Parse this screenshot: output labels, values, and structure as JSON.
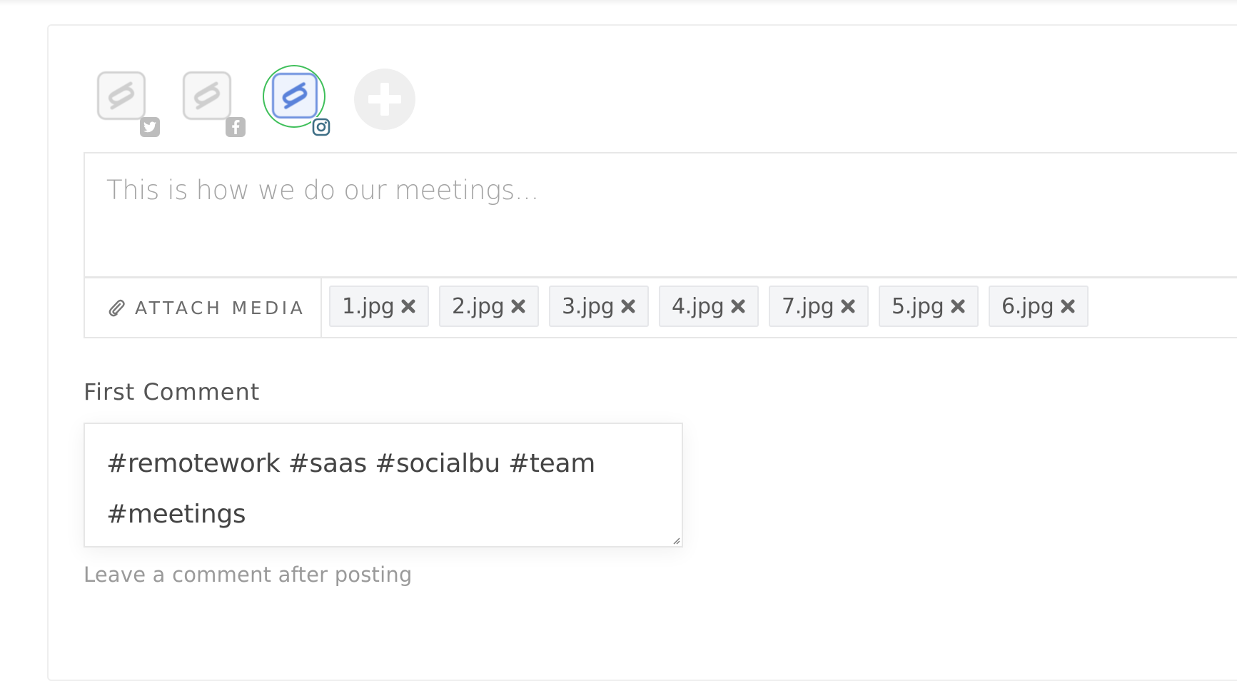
{
  "accounts": [
    {
      "network": "twitter",
      "logo_icon": "socialbu-logo-icon",
      "badge_icon": "twitter-icon",
      "selected": false
    },
    {
      "network": "facebook",
      "logo_icon": "socialbu-logo-icon",
      "badge_icon": "facebook-icon",
      "selected": false
    },
    {
      "network": "instagram",
      "logo_icon": "socialbu-logo-icon",
      "badge_icon": "instagram-icon",
      "selected": true
    }
  ],
  "add_account_icon": "plus-icon",
  "editor": {
    "placeholder": "This is how we do our meetings..."
  },
  "media": {
    "attach_label": "ATTACH MEDIA",
    "attach_icon": "paperclip-icon",
    "remove_icon": "close-icon",
    "files": [
      "1.jpg",
      "2.jpg",
      "3.jpg",
      "4.jpg",
      "7.jpg",
      "5.jpg",
      "6.jpg"
    ]
  },
  "first_comment": {
    "label": "First Comment",
    "value": "#remotework #saas #socialbu #team\n#meetings",
    "help_text": "Leave a comment after posting"
  },
  "colors": {
    "selected_ring": "#3fbf5a",
    "active_logo": "#6f92df",
    "inactive_logo": "#d2d2d2",
    "chip_bg": "#f4f5f7"
  }
}
